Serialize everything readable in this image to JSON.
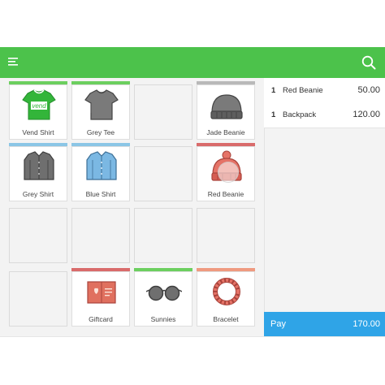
{
  "colors": {
    "header": "#4cc24b",
    "pay": "#2fa4e7",
    "green": "#6ccf5f",
    "grey": "#b9b9b9",
    "blue": "#8bc6e6",
    "red": "#d96b6b",
    "salmon": "#ef9a80"
  },
  "header": {
    "menu_icon": "hamburger-menu-icon",
    "search_icon": "search-icon"
  },
  "tiles": [
    {
      "label": "Vend Shirt",
      "icon": "vend-shirt-icon",
      "badge": "vend"
    },
    {
      "label": "Grey Tee",
      "icon": "grey-tee-icon"
    },
    {
      "label": "Jade Beanie",
      "icon": "beanie-icon"
    },
    {
      "label": "Grey Shirt",
      "icon": "grey-shirt-icon"
    },
    {
      "label": "Blue Shirt",
      "icon": "blue-shirt-icon"
    },
    {
      "label": "Red Beanie",
      "icon": "red-beanie-icon"
    },
    {
      "label": "Giftcard",
      "icon": "giftcard-icon"
    },
    {
      "label": "Sunnies",
      "icon": "sunglasses-icon"
    },
    {
      "label": "Bracelet",
      "icon": "bracelet-icon"
    }
  ],
  "sale": {
    "lines": [
      {
        "qty": "1",
        "name": "Red Beanie",
        "price": "50.00"
      },
      {
        "qty": "1",
        "name": "Backpack",
        "price": "120.00"
      }
    ],
    "pay_label": "Pay",
    "total": "170.00"
  }
}
